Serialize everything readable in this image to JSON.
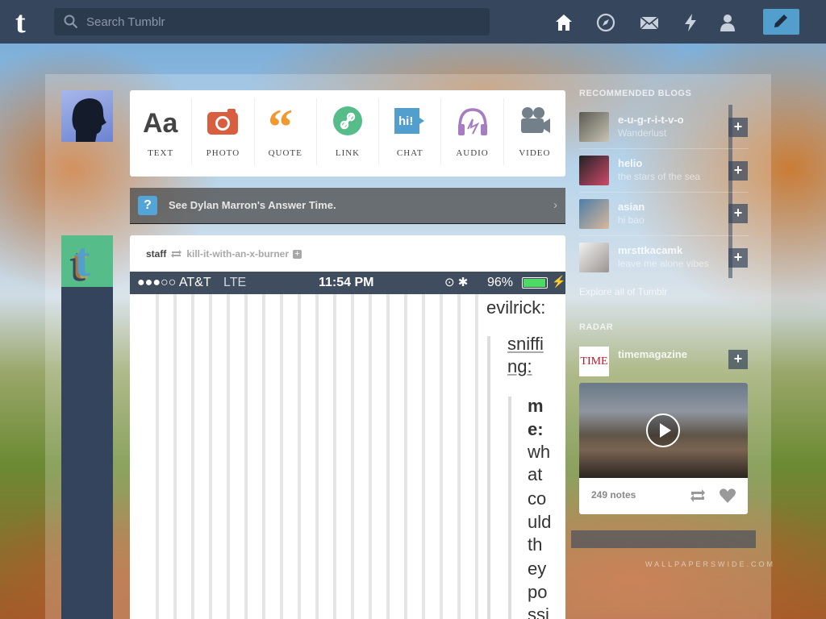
{
  "header": {
    "search_placeholder": "Search Tumblr",
    "nav_icons": [
      "home-icon",
      "explore-icon",
      "inbox-icon",
      "activity-icon",
      "account-icon"
    ],
    "compose_icon": "pencil-icon"
  },
  "post_types": [
    {
      "label": "TEXT",
      "icon": "text-icon",
      "color": "#444444"
    },
    {
      "label": "PHOTO",
      "icon": "camera-icon",
      "color": "#d95e40"
    },
    {
      "label": "QUOTE",
      "icon": "quote-icon",
      "color": "#f2992e"
    },
    {
      "label": "LINK",
      "icon": "link-icon",
      "color": "#56bc8a"
    },
    {
      "label": "CHAT",
      "icon": "chat-icon",
      "color": "#529ecc"
    },
    {
      "label": "AUDIO",
      "icon": "headphones-icon",
      "color": "#a77dc2"
    },
    {
      "label": "VIDEO",
      "icon": "video-camera-icon",
      "color": "#748089"
    }
  ],
  "answer_time": {
    "text": "See Dylan Marron's Answer Time."
  },
  "post": {
    "author": "staff",
    "source": "kill-it-with-an-x-burner",
    "status_bar": {
      "carrier": "●●●○○ AT&T",
      "network": "LTE",
      "time": "11:54 PM",
      "battery_pct": "96%"
    },
    "chat": {
      "user1": "evilrick:",
      "user2_line1": "sniffi",
      "user2_line2": "ng:",
      "reply_lines": [
        "m",
        "e:",
        "wh",
        "at",
        "co",
        "uld",
        "th",
        "ey",
        "po",
        "ssi"
      ]
    }
  },
  "sidebar": {
    "recommended_title": "RECOMMENDED BLOGS",
    "blogs": [
      {
        "name": "e-u-g-r-i-t-v-o",
        "sub": "Wanderlust"
      },
      {
        "name": "helio",
        "sub": "the stars of the sea"
      },
      {
        "name": "asian",
        "sub": "hi bao"
      },
      {
        "name": "mrsttkacamk",
        "sub": "leave me alone vibes"
      }
    ],
    "explore_text": "Explore all of Tumblr",
    "radar_title": "RADAR",
    "radar_blog": "timemagazine",
    "radar_logo": "TIME",
    "radar_notes": "249 notes"
  },
  "watermark": "WALLPAPERSWIDE.COM"
}
